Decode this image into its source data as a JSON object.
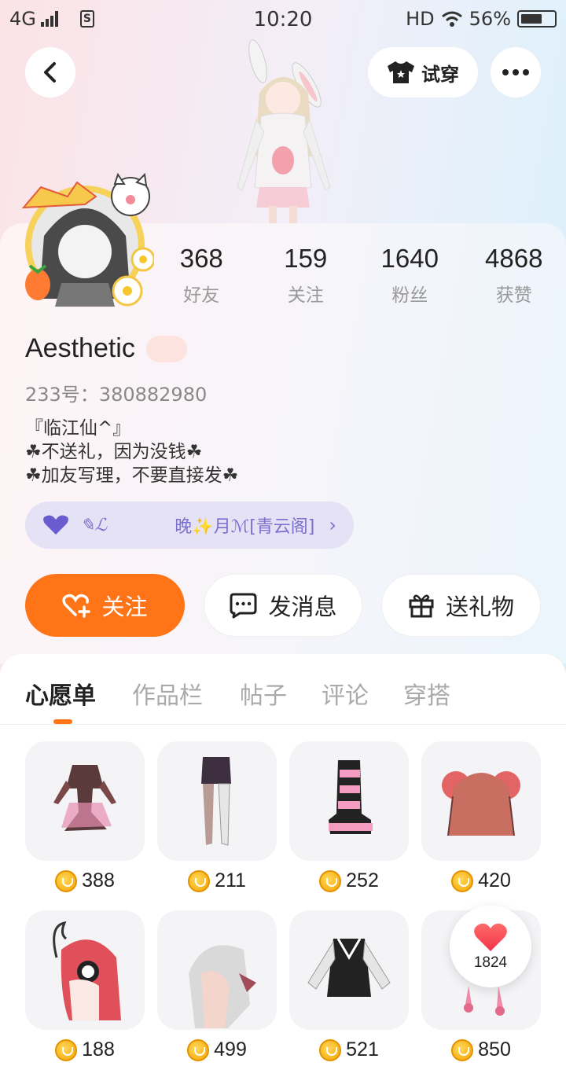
{
  "status_bar": {
    "network": "4G",
    "sim_label": "S",
    "time": "10:20",
    "hd": "HD",
    "battery": "56%"
  },
  "header": {
    "try_on_label": "试穿"
  },
  "profile": {
    "stats": [
      {
        "value": "368",
        "label": "好友"
      },
      {
        "value": "159",
        "label": "关注"
      },
      {
        "value": "1640",
        "label": "粉丝"
      },
      {
        "value": "4868",
        "label": "获赞"
      }
    ],
    "username": "Aesthetic",
    "uid": "233号：380882980",
    "bio": [
      "『临江仙^』",
      "☘不送礼，因为没钱☘",
      "☘加友写理，不要直接发☘"
    ],
    "guild": {
      "badge": "✎ℒ",
      "name": "晚✨月ℳ[青云阁]"
    }
  },
  "actions": {
    "follow": "关注",
    "message": "发消息",
    "gift": "送礼物"
  },
  "tabs": [
    "心愿单",
    "作品栏",
    "帖子",
    "评论",
    "穿搭"
  ],
  "items": [
    {
      "price": "388",
      "icon": "outfit-dress"
    },
    {
      "price": "211",
      "icon": "stockings"
    },
    {
      "price": "252",
      "icon": "boots"
    },
    {
      "price": "420",
      "icon": "hair-buns"
    },
    {
      "price": "188",
      "icon": "hair-red"
    },
    {
      "price": "499",
      "icon": "hair-white"
    },
    {
      "price": "521",
      "icon": "jacket"
    },
    {
      "price": "850",
      "icon": "accessory"
    }
  ],
  "like_bubble": {
    "count": "1824"
  },
  "colors": {
    "accent": "#ff7417",
    "guild_bg": "#e5e2f6",
    "guild_text": "#7b6fd0"
  }
}
